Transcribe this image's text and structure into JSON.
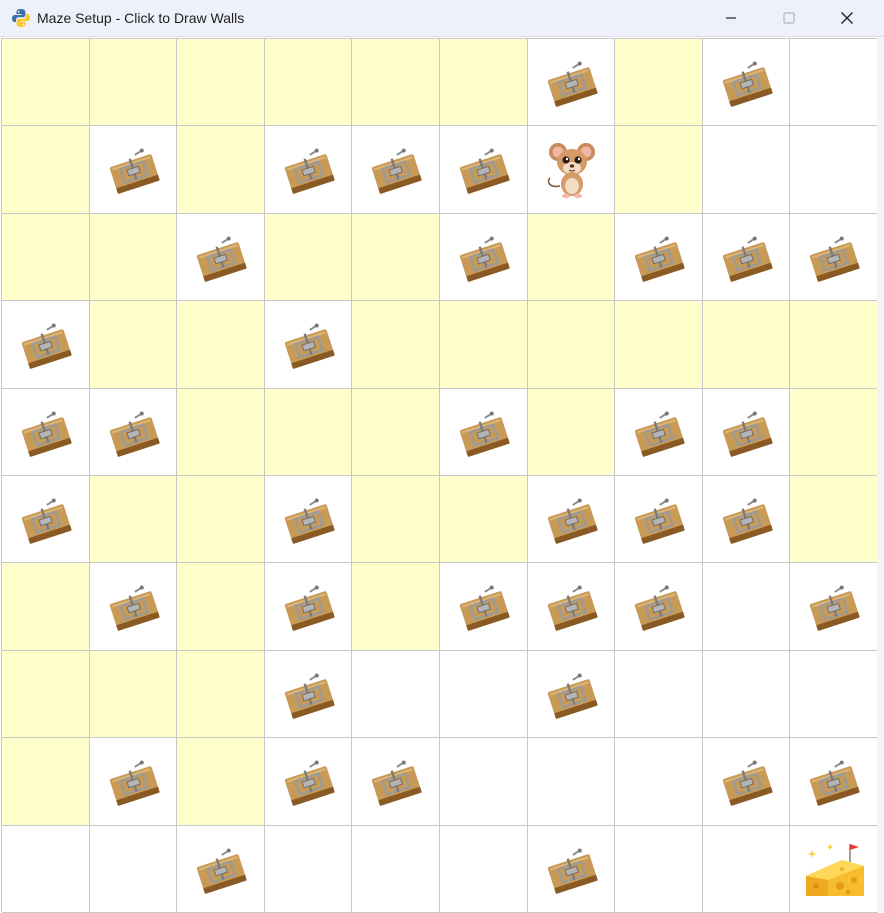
{
  "window": {
    "title": "Maze Setup - Click to Draw Walls",
    "app_icon": "python-icon",
    "controls": [
      {
        "name": "minimize-button",
        "icon": "minimize-icon"
      },
      {
        "name": "maximize-button",
        "icon": "maximize-icon"
      },
      {
        "name": "close-button",
        "icon": "close-icon"
      }
    ]
  },
  "legend": {
    "P": "path cell (highlighted)",
    "T": "trap cell (mousetrap)",
    "M": "mouse (start)",
    "C": "cheese (goal)",
    ".": "empty cell"
  },
  "colors": {
    "path": "#ffffcc",
    "empty": "#ffffff",
    "grid_line": "#c8c8c8",
    "titlebar": "#eef1fa"
  },
  "maze": {
    "rows": 10,
    "cols": 10,
    "cells": [
      [
        "P",
        "P",
        "P",
        "P",
        "P",
        "P",
        "T",
        "P",
        "T",
        "."
      ],
      [
        "P",
        "T",
        "P",
        "T",
        "T",
        "T",
        "M",
        "P",
        ".",
        "."
      ],
      [
        "P",
        "P",
        "T",
        "P",
        "P",
        "T",
        "P",
        "T",
        "T",
        "T"
      ],
      [
        "T",
        "P",
        "P",
        "T",
        "P",
        "P",
        "P",
        "P",
        "P",
        "P"
      ],
      [
        "T",
        "T",
        "P",
        "P",
        "P",
        "T",
        "P",
        "T",
        "T",
        "P"
      ],
      [
        "T",
        "P",
        "P",
        "T",
        "P",
        "P",
        "T",
        "T",
        "T",
        "P"
      ],
      [
        "P",
        "T",
        "P",
        "T",
        "P",
        "T",
        "T",
        "T",
        ".",
        "T"
      ],
      [
        "P",
        "P",
        "P",
        "T",
        ".",
        ".",
        "T",
        ".",
        ".",
        "."
      ],
      [
        "P",
        "T",
        "P",
        "T",
        "T",
        ".",
        ".",
        ".",
        "T",
        "T"
      ],
      [
        ".",
        ".",
        "T",
        ".",
        ".",
        ".",
        "T",
        ".",
        ".",
        "C"
      ]
    ]
  }
}
